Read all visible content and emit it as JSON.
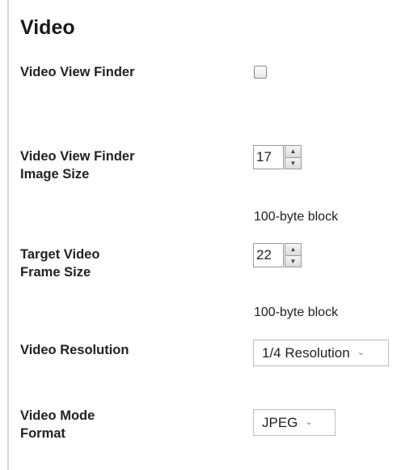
{
  "section": {
    "title": "Video"
  },
  "fields": {
    "view_finder": {
      "label": "Video View Finder",
      "checked": false
    },
    "view_finder_image_size": {
      "label": "Video View Finder\nImage Size",
      "value": "17",
      "unit": "100-byte block"
    },
    "target_frame_size": {
      "label": "Target Video\nFrame Size",
      "value": "22",
      "unit": "100-byte block"
    },
    "resolution": {
      "label": "Video Resolution",
      "selected": "1/4 Resolution"
    },
    "mode_format": {
      "label": "Video Mode\nFormat",
      "selected": "JPEG"
    }
  },
  "icons": {
    "spin_up": "arrow-up-icon",
    "spin_down": "arrow-down-icon",
    "dropdown": "chevron-down-icon"
  }
}
